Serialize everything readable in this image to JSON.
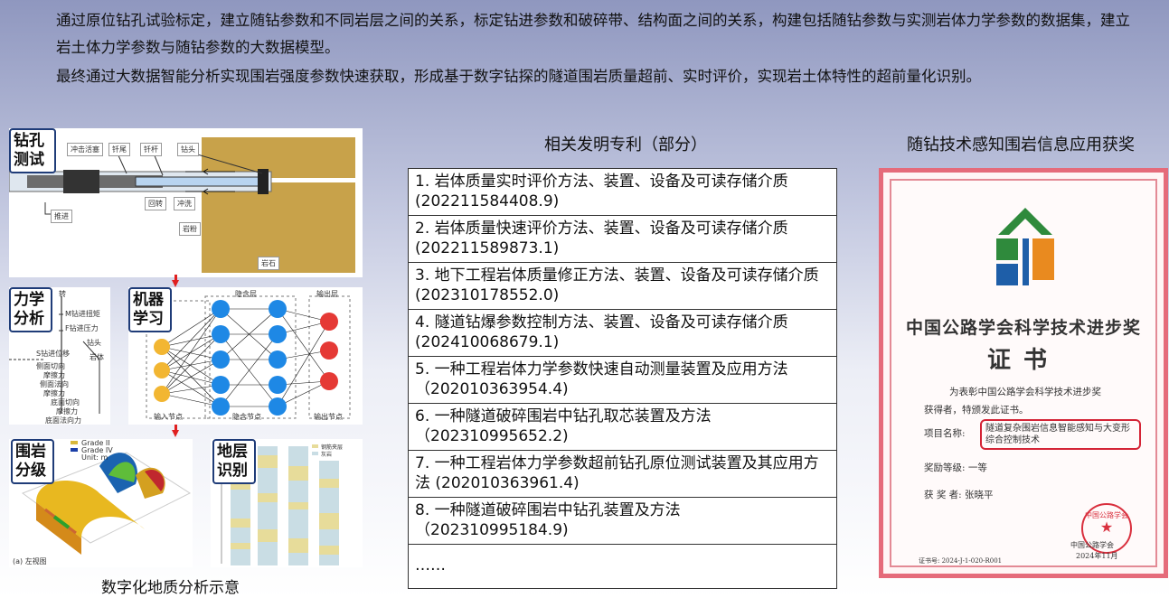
{
  "intro": {
    "p1": "通过原位钻孔试验标定，建立随钻参数和不同岩层之间的关系，标定钻进参数和破碎带、结构面之间的关系，构建包括随钻参数与实测岩体力学参数的数据集，建立岩土体力学参数与随钻参数的大数据模型。",
    "p2": "最终通过大数据智能分析实现围岩强度参数快速获取，形成基于数字钻探的隧道围岩质量超前、实时评价，实现岩土体特性的超前量化识别。"
  },
  "left": {
    "tags": {
      "drill": "钻孔测试",
      "mech": "力学分析",
      "ml": "机器学习",
      "grade": "围岩分级",
      "layer": "地层识别"
    },
    "drill_labels": {
      "hammer": "冲击活塞",
      "shank": "钎尾",
      "rod": "钎杆",
      "bit": "钻头",
      "rotate": "回转",
      "flush": "冲洗",
      "powder": "岩粉",
      "push": "推进",
      "rock": "岩石"
    },
    "mech_labels": {
      "rot": "转",
      "m": "M钻进扭矩",
      "f": "F钻进压力",
      "bit": "钻头",
      "s": "S钻进位移",
      "side1": "侧面切向",
      "side1b": "摩擦力",
      "side2": "侧面法向",
      "side2b": "摩擦力",
      "rock": "岩体",
      "base1": "底面切向",
      "base1b": "摩擦力",
      "base2": "底面法向力"
    },
    "nn_labels": {
      "hidden": "隐含层",
      "out": "输出层",
      "in_nodes": "输入节点",
      "hid_nodes": "隐含节点",
      "out_nodes": "输出节点"
    },
    "grade_legend": [
      "Grade II",
      "Grade IV",
      "Unit: m"
    ],
    "grade_caption": "(a) 左视图",
    "layer_legend": [
      "钢筋夹层",
      "灰岩"
    ],
    "caption": "数字化地质分析示意"
  },
  "patents": {
    "title": "相关发明专利（部分）",
    "items": [
      "1. 岩体质量实时评价方法、装置、设备及可读存储介质 (202211584408.9)",
      "2. 岩体质量快速评价方法、装置、设备及可读存储介质 (202211589873.1)",
      "3. 地下工程岩体质量修正方法、装置、设备及可读存储介质 (202310178552.0)",
      "4. 隧道钻爆参数控制方法、装置、设备及可读存储介质 (202410068679.1)",
      "5. 一种工程岩体力学参数快速自动测量装置及应用方法（202010363954.4)",
      "6. 一种隧道破碎围岩中钻孔取芯装置及方法（202310995652.2)",
      "7. 一种工程岩体力学参数超前钻孔原位测试装置及其应用方法 (202010363961.4)",
      "8. 一种隧道破碎围岩中钻孔装置及方法（202310995184.9)",
      "……"
    ]
  },
  "cert": {
    "title": "随钻技术感知围岩信息应用获奖",
    "heading": "中国公路学会科学技术进步奖",
    "heading2": "证书",
    "line1": "为表彰中国公路学会科学技术进步奖",
    "line2": "获得者，特颁发此证书。",
    "proj_label": "项目名称:",
    "proj_name": "隧道复杂围岩信息智能感知与大变形综合控制技术",
    "level_label": "奖励等级: 一等",
    "winner_label": "获 奖 者: 张晓平",
    "seal_org": "中国公路学会",
    "seal_text": "中国公路学会",
    "date": "2024年11月",
    "number": "证书号: 2024-J-1-020-R001"
  },
  "colors": {
    "accent_red": "#d42436",
    "tag_border": "#1f3c78",
    "cert_logo_green": "#2f8a3c",
    "cert_logo_orange": "#e98a1f",
    "cert_logo_blue": "#1e5ea8"
  }
}
